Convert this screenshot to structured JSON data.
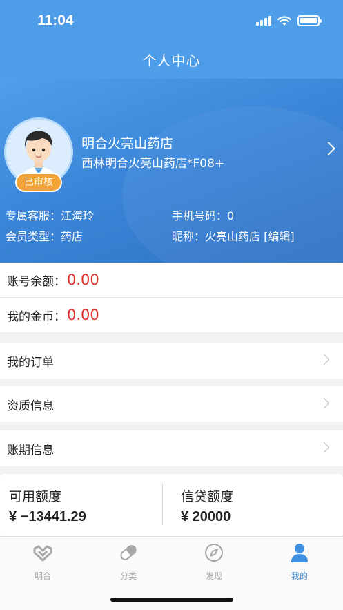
{
  "status_bar": {
    "time": "11:04"
  },
  "header": {
    "title": "个人中心"
  },
  "profile": {
    "name": "明合火亮山药店",
    "subtitle": "西林明合火亮山药店*F08+",
    "badge": "已审核",
    "service_label": "专属客服：",
    "service_value": "江海玲",
    "phone_label": "手机号码：",
    "phone_value": "0",
    "member_label": "会员类型：",
    "member_value": "药店",
    "nickname_label": "昵称：",
    "nickname_value": "火亮山药店",
    "edit_label": "[编辑]"
  },
  "balances": [
    {
      "label": "账号余额：",
      "value": "0.00"
    },
    {
      "label": "我的金币：",
      "value": "0.00"
    }
  ],
  "menu": [
    {
      "label": "我的订单"
    },
    {
      "label": "资质信息"
    },
    {
      "label": "账期信息"
    }
  ],
  "credit": {
    "available_label": "可用额度",
    "available_value": "¥ −13441.29",
    "credit_label": "信贷额度",
    "credit_value": "¥ 20000"
  },
  "tabs": [
    {
      "label": "明合",
      "icon": "heart-logo-icon"
    },
    {
      "label": "分类",
      "icon": "pill-icon"
    },
    {
      "label": "发现",
      "icon": "compass-icon"
    },
    {
      "label": "我的",
      "icon": "person-icon"
    }
  ],
  "colors": {
    "accent": "#4d9de8",
    "amount_red": "#e0302a",
    "badge_orange": "#f3a237"
  }
}
